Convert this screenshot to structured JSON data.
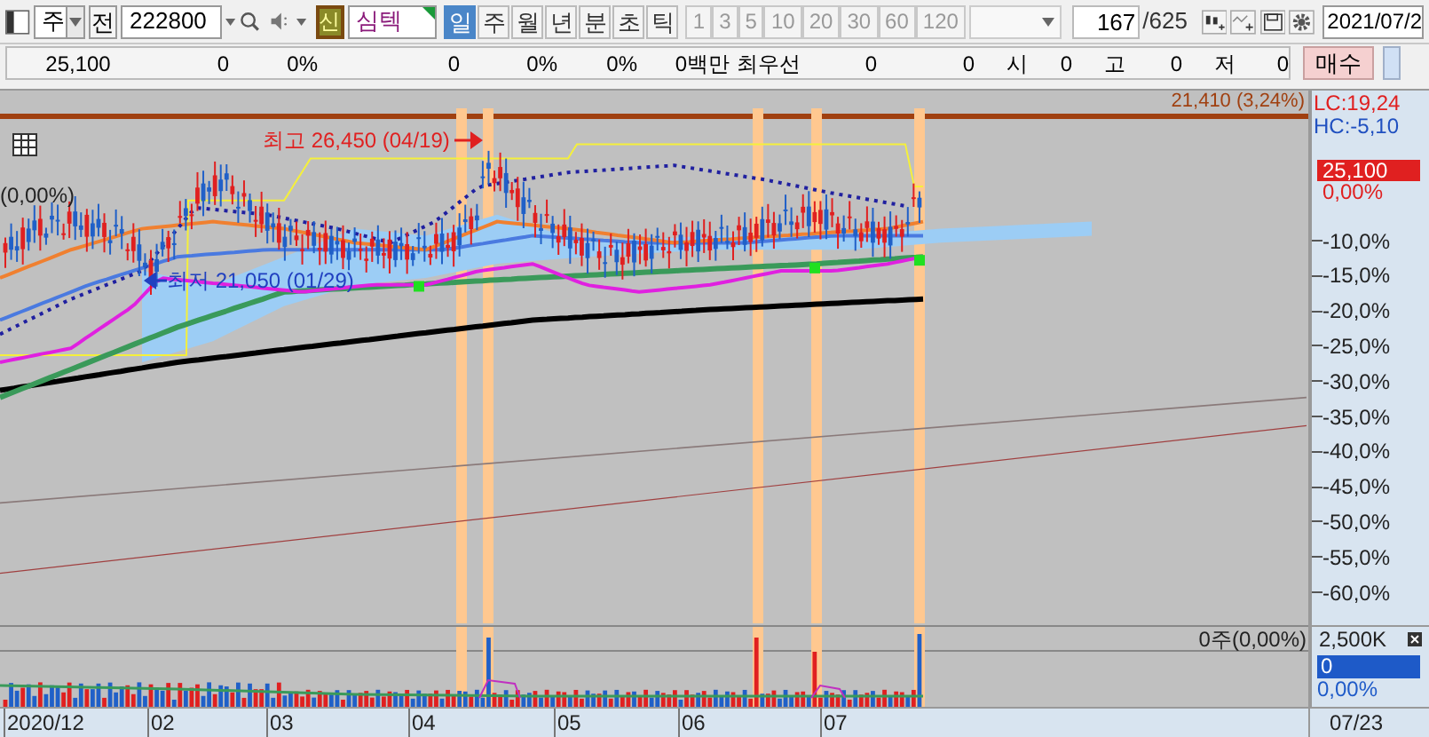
{
  "toolbar": {
    "market": "주",
    "prev_button": "전",
    "code": "222800",
    "credit_badge": "신",
    "name": "심텍",
    "periods": [
      {
        "label": "일",
        "selected": true
      },
      {
        "label": "주",
        "selected": false
      },
      {
        "label": "월",
        "selected": false
      },
      {
        "label": "년",
        "selected": false
      },
      {
        "label": "분",
        "selected": false
      },
      {
        "label": "초",
        "selected": false
      },
      {
        "label": "틱",
        "selected": false
      }
    ],
    "intervals": [
      {
        "label": "1",
        "disabled": true
      },
      {
        "label": "3",
        "disabled": true
      },
      {
        "label": "5",
        "disabled": true
      },
      {
        "label": "10",
        "disabled": true
      },
      {
        "label": "20",
        "disabled": true
      },
      {
        "label": "30",
        "disabled": true
      },
      {
        "label": "60",
        "disabled": true
      },
      {
        "label": "120",
        "disabled": true
      }
    ],
    "count": "167",
    "total": "/625",
    "date": "2021/07/2"
  },
  "quote_bar": {
    "cells": [
      "25,100",
      "0",
      "0%",
      "0",
      "0%",
      "0%",
      "0백만",
      "최우선",
      "0",
      "0",
      "시",
      "0",
      "고",
      "0",
      "저",
      "0"
    ],
    "buy_button": "매수"
  },
  "chart": {
    "price_line_label": "21,410 (3,24%)",
    "left_label": "(0,00%)",
    "high_note": "최고 26,450 (04/19)",
    "low_note": "최저 21,050 (01/29)",
    "lc": "LC:19,24",
    "hc": "HC:-5,10",
    "price_tag": "25,100",
    "change": "0,00%",
    "y_ticks": [
      "-10,0%",
      "-15,0%",
      "-20,0%",
      "-25,0%",
      "-30,0%",
      "-35,0%",
      "-40,0%",
      "-45,0%",
      "-50,0%",
      "-55,0%",
      "-60,0%"
    ]
  },
  "volume": {
    "label": "0주(0,00%)",
    "max_tick": "2,500K",
    "value_tag": "0",
    "change": "0,00%"
  },
  "dates": [
    "2020/12",
    "02",
    "03",
    "04",
    "05",
    "06",
    "07"
  ],
  "cursor_date": "07/23"
}
